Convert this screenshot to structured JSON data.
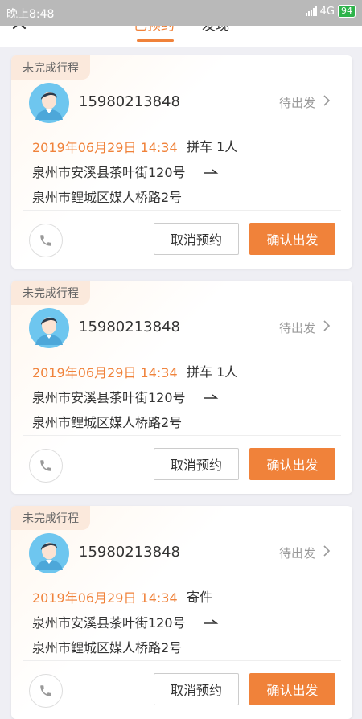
{
  "status_bar": {
    "time": "晚上8:48",
    "network": "4G",
    "battery": "94"
  },
  "tabs": [
    {
      "label": "已预约",
      "active": true
    },
    {
      "label": "发现",
      "active": false
    }
  ],
  "colors": {
    "accent": "#f0823a",
    "badge_bg": "#fbe9dc"
  },
  "trips": [
    {
      "badge": "未完成行程",
      "phone": "15980213848",
      "status": "待出发",
      "datetime": "2019年06月29日 14:34",
      "ride_type": "拼车 1人",
      "from": "泉州市安溪县茶叶街120号",
      "to": "泉州市鲤城区媒人桥路2号",
      "cancel_label": "取消预约",
      "confirm_label": "确认出发"
    },
    {
      "badge": "未完成行程",
      "phone": "15980213848",
      "status": "待出发",
      "datetime": "2019年06月29日 14:34",
      "ride_type": "拼车 1人",
      "from": "泉州市安溪县茶叶街120号",
      "to": "泉州市鲤城区媒人桥路2号",
      "cancel_label": "取消预约",
      "confirm_label": "确认出发"
    },
    {
      "badge": "未完成行程",
      "phone": "15980213848",
      "status": "待出发",
      "datetime": "2019年06月29日 14:34",
      "ride_type": "寄件",
      "from": "泉州市安溪县茶叶街120号",
      "to": "泉州市鲤城区媒人桥路2号",
      "cancel_label": "取消预约",
      "confirm_label": "确认出发"
    }
  ]
}
